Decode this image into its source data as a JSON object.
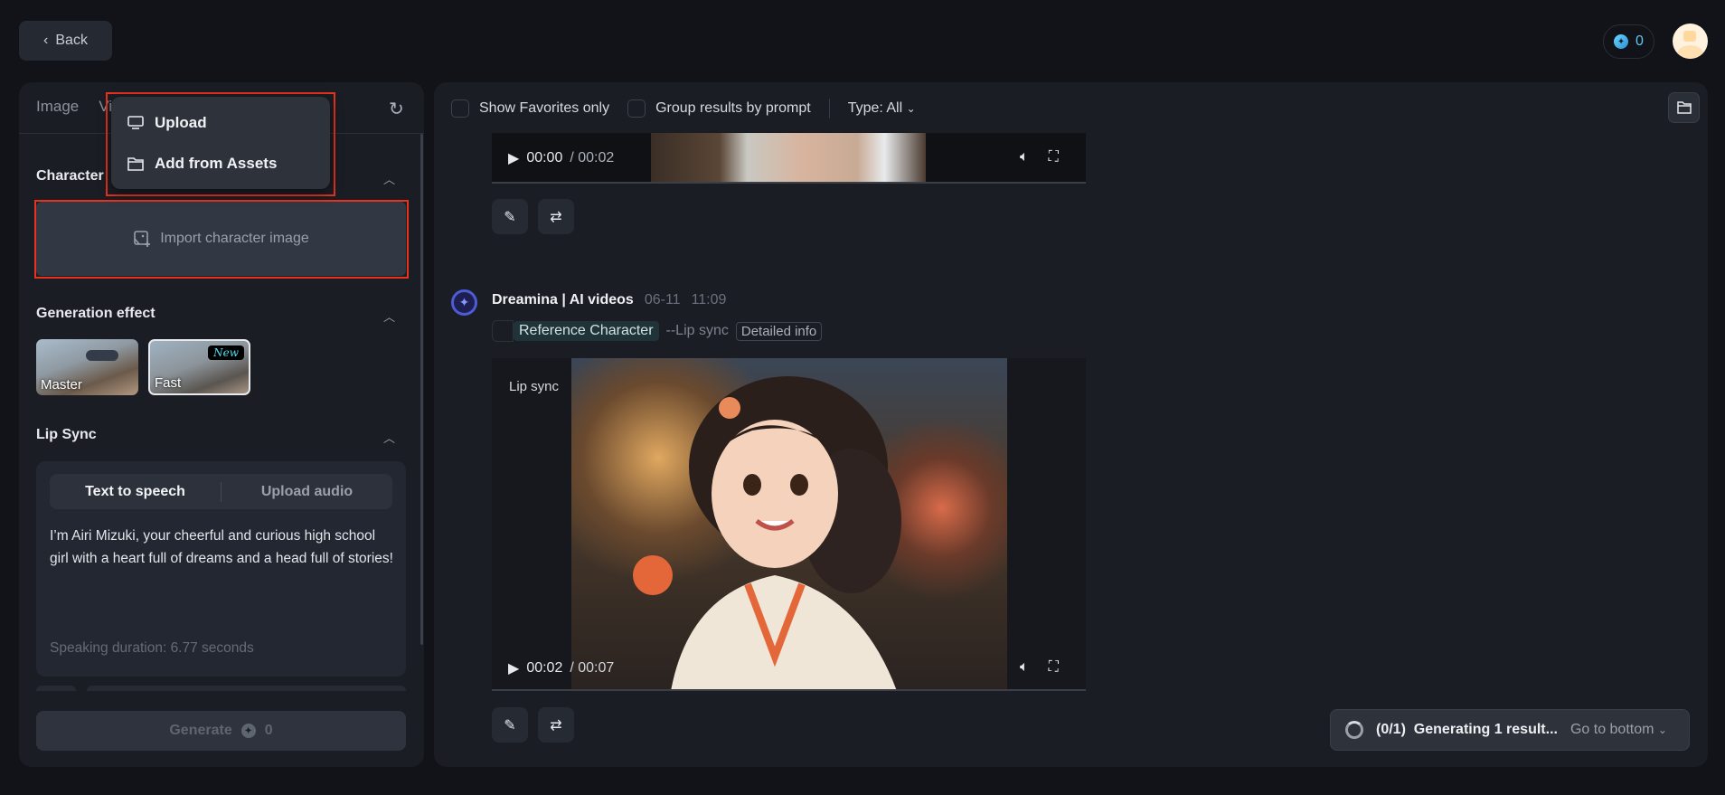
{
  "header": {
    "back_label": "Back",
    "credits": "0"
  },
  "left": {
    "tabs": [
      "Image",
      "Video"
    ],
    "dropdown": {
      "items": [
        "Upload",
        "Add from Assets"
      ]
    },
    "character": {
      "title": "Character",
      "import_label": "Import character image"
    },
    "generation_effect": {
      "title": "Generation effect",
      "options": [
        {
          "label": "Master"
        },
        {
          "label": "Fast",
          "badge": "New"
        }
      ]
    },
    "lip_sync": {
      "title": "Lip Sync",
      "tabs": [
        "Text to speech",
        "Upload audio"
      ],
      "active_tab": "Text to speech",
      "text": "I’m Airi Mizuki, your cheerful and curious high school girl with a heart full of dreams and a head full of stories!",
      "duration": "Speaking duration: 6.77 seconds"
    },
    "generate": {
      "label": "Generate",
      "cost": "0"
    }
  },
  "right": {
    "toolbar": {
      "favorites_label": "Show Favorites only",
      "group_label": "Group results by prompt",
      "type_label": "Type: All"
    },
    "video1": {
      "current": "00:00",
      "sep": " / ",
      "duration": "00:02"
    },
    "entry": {
      "author": "Dreamina | AI videos",
      "date": "06-11",
      "time": "11:09",
      "tag": "Reference Character",
      "mode": "--Lip sync",
      "info_label": "Detailed info"
    },
    "video2": {
      "overlay_label": "Lip sync",
      "current": "00:02",
      "sep": " / ",
      "duration": "00:07"
    },
    "toast": {
      "count": "(0/1)",
      "status": "Generating 1 result...",
      "action": "Go to bottom"
    }
  },
  "colors": {
    "highlight": "#e8321e",
    "credit": "#5ec8f0",
    "accent": "#4f5bd5"
  }
}
